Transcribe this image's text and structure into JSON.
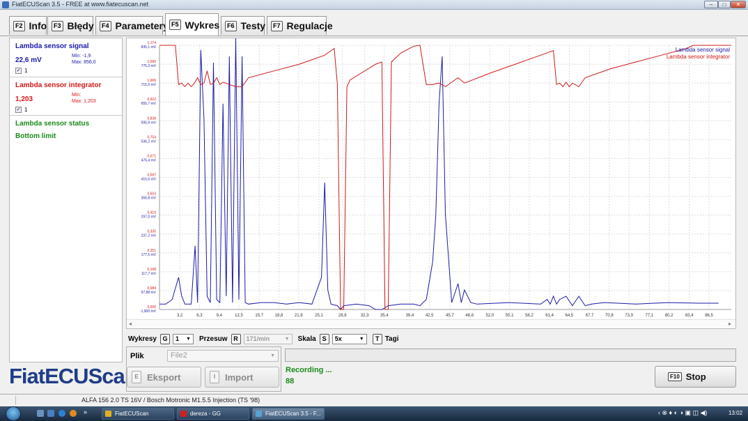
{
  "window": {
    "title": "FiatECUScan 3.5 - FREE at www.fiatecuscan.net",
    "minimize_glyph": "–",
    "maximize_glyph": "□",
    "close_glyph": "✕"
  },
  "tabs": [
    {
      "key": "F2",
      "label": "Info"
    },
    {
      "key": "F3",
      "label": "Błędy"
    },
    {
      "key": "F4",
      "label": "Parametery"
    },
    {
      "key": "F5",
      "label": "Wykres",
      "active": true
    },
    {
      "key": "F6",
      "label": "Testy"
    },
    {
      "key": "F7",
      "label": "Regulacje"
    }
  ],
  "signals": {
    "lambda_signal": {
      "name": "Lambda sensor signal",
      "value": "22,6 mV",
      "min": "Min: -1,9",
      "max": "Max: 856,0",
      "checked": "✓",
      "check_label": "1",
      "color": "#1a1aa8"
    },
    "lambda_integrator": {
      "name": "Lambda sensor integrator",
      "value": "1,203",
      "min": "Min:",
      "max": "Max: 1,203",
      "checked": "✓",
      "check_label": "1",
      "color": "#d01818"
    },
    "lambda_status": {
      "name": "Lambda sensor status",
      "value": "Bottom limit",
      "color": "#1a8a1a"
    }
  },
  "logo": "FiatECUScan",
  "chart_data": {
    "type": "line",
    "legend_placement": "top-right",
    "grid": true,
    "x_ticks": [
      "3,2",
      "6,3",
      "9,4",
      "12,5",
      "15,7",
      "18,8",
      "21,9",
      "25,1",
      "28,8",
      "32,3",
      "35,4",
      "39,4",
      "42,5",
      "45,7",
      "48,8",
      "52,0",
      "55,1",
      "58,2",
      "61,4",
      "64,5",
      "67,7",
      "70,8",
      "73,9",
      "77,1",
      "80,2",
      "83,4",
      "86,5"
    ],
    "xlim": [
      0,
      90
    ],
    "y_ticks_integrator": [
      "0,000",
      "0,084",
      "0,168",
      "0,251",
      "0,335",
      "0,419",
      "0,503",
      "0,587",
      "0,671",
      "0,754",
      "0,838",
      "0,922",
      "1,006",
      "1,090",
      "1,174"
    ],
    "y_ticks_signal": [
      "-1,900 mV",
      "57,88 mV",
      "117,7 mV",
      "177,5 mV",
      "237,2 mV",
      "297,0 mV",
      "356,8 mV",
      "416,6 mV",
      "476,4 mV",
      "536,2 mV",
      "595,9 mV",
      "655,7 mV",
      "715,5 mV",
      "775,3 mV",
      "835,1 mV"
    ],
    "series": [
      {
        "name": "Lambda sensor signal",
        "color": "#1a1aa8",
        "points": [
          [
            0,
            15
          ],
          [
            1,
            15
          ],
          [
            2,
            30
          ],
          [
            3,
            100
          ],
          [
            3.5,
            40
          ],
          [
            4,
            15
          ],
          [
            5,
            15
          ],
          [
            5.6,
            200
          ],
          [
            6,
            20
          ],
          [
            6.5,
            820
          ],
          [
            7,
            600
          ],
          [
            7.5,
            40
          ],
          [
            8,
            20
          ],
          [
            8.5,
            780
          ],
          [
            9,
            30
          ],
          [
            9.5,
            20
          ],
          [
            10,
            650
          ],
          [
            10.5,
            40
          ],
          [
            11,
            800
          ],
          [
            11.5,
            20
          ],
          [
            12,
            860
          ],
          [
            12.5,
            30
          ],
          [
            13,
            800
          ],
          [
            13.5,
            20
          ],
          [
            14,
            15
          ],
          [
            16,
            20
          ],
          [
            18,
            20
          ],
          [
            20,
            15
          ],
          [
            22,
            20
          ],
          [
            24,
            15
          ],
          [
            25.5,
            100
          ],
          [
            26,
            400
          ],
          [
            26.5,
            60
          ],
          [
            27,
            15
          ],
          [
            28,
            10
          ],
          [
            28.5,
            -2
          ],
          [
            29,
            10
          ],
          [
            31,
            15
          ],
          [
            33,
            10
          ],
          [
            34,
            -2
          ],
          [
            35,
            -2
          ],
          [
            36,
            10
          ],
          [
            38,
            15
          ],
          [
            40,
            15
          ],
          [
            41,
            10
          ],
          [
            42,
            30
          ],
          [
            43,
            150
          ],
          [
            43.5,
            300
          ],
          [
            44,
            650
          ],
          [
            44.5,
            800
          ],
          [
            45,
            300
          ],
          [
            46,
            20
          ],
          [
            47,
            80
          ],
          [
            47.5,
            20
          ],
          [
            48,
            60
          ],
          [
            49,
            20
          ],
          [
            50,
            15
          ],
          [
            55,
            20
          ],
          [
            60,
            15
          ],
          [
            61,
            30
          ],
          [
            61.5,
            15
          ],
          [
            62,
            40
          ],
          [
            62.5,
            15
          ],
          [
            63,
            30
          ],
          [
            64,
            40
          ],
          [
            65,
            10
          ],
          [
            66,
            40
          ],
          [
            67,
            10
          ],
          [
            68,
            15
          ],
          [
            70,
            20
          ],
          [
            75,
            15
          ],
          [
            80,
            20
          ],
          [
            85,
            18
          ],
          [
            88,
            18
          ]
        ]
      },
      {
        "name": "Lambda sensor integrator",
        "color": "#d01818",
        "points": [
          [
            0,
            1.174
          ],
          [
            2.5,
            1.174
          ],
          [
            3,
            1.0
          ],
          [
            3.5,
            1.006
          ],
          [
            4,
            0.99
          ],
          [
            4.5,
            1.006
          ],
          [
            5,
            0.99
          ],
          [
            5.5,
            1.006
          ],
          [
            6,
            1.03
          ],
          [
            6.5,
            1.0
          ],
          [
            7,
            1.006
          ],
          [
            7.5,
            1.06
          ],
          [
            8,
            1.0
          ],
          [
            8.5,
            1.006
          ],
          [
            9,
            1.03
          ],
          [
            9.5,
            1.0
          ],
          [
            10,
            1.01
          ],
          [
            11,
            1.0
          ],
          [
            12,
            0.99
          ],
          [
            13,
            0.99
          ],
          [
            14,
            1.03
          ],
          [
            18,
            1.06
          ],
          [
            22,
            1.09
          ],
          [
            26,
            1.13
          ],
          [
            27.5,
            1.16
          ],
          [
            28,
            1.0
          ],
          [
            28.5,
            0.0
          ],
          [
            29,
            0.0
          ],
          [
            29.5,
            0.99
          ],
          [
            30,
            1.02
          ],
          [
            34,
            1.09
          ],
          [
            35,
            1.1
          ],
          [
            35.5,
            0.0
          ],
          [
            36,
            0.0
          ],
          [
            36.5,
            1.1
          ],
          [
            38,
            1.14
          ],
          [
            40,
            1.17
          ],
          [
            41,
            1.174
          ],
          [
            42,
            1.0
          ],
          [
            43,
            1.0
          ],
          [
            44,
            1.006
          ],
          [
            45,
            0.99
          ],
          [
            46,
            1.01
          ],
          [
            47,
            1.03
          ],
          [
            48,
            1.006
          ],
          [
            52,
            1.05
          ],
          [
            56,
            1.09
          ],
          [
            60,
            1.13
          ],
          [
            62,
            1.15
          ],
          [
            62.5,
            1.0
          ],
          [
            63,
            1.006
          ],
          [
            63.5,
            0.99
          ],
          [
            64,
            1.01
          ],
          [
            64.5,
            0.99
          ],
          [
            65,
            1.006
          ],
          [
            66,
            0.99
          ],
          [
            67,
            1.03
          ],
          [
            71,
            1.07
          ],
          [
            75,
            1.1
          ],
          [
            79,
            1.13
          ],
          [
            83,
            1.16
          ],
          [
            84,
            1.174
          ],
          [
            90,
            1.174
          ]
        ]
      }
    ]
  },
  "controls": {
    "wykresy_label": "Wykresy",
    "wykresy_key": "G",
    "wykresy_value": "1",
    "przesuw_label": "Przesuw",
    "przesuw_key": "R",
    "przesuw_value": "171/min",
    "skala_label": "Skala",
    "skala_key": "S",
    "skala_value": "5x",
    "tagi_key": "T",
    "tagi_label": "Tagi",
    "dropdown_glyph": "▼"
  },
  "file": {
    "label": "Plik",
    "value": "File2",
    "export_key": "E",
    "export_label": "Eksport",
    "import_key": "I",
    "import_label": "Import"
  },
  "recording": {
    "status": "Recording ...",
    "count": "88"
  },
  "stop": {
    "key": "F10",
    "label": "Stop"
  },
  "statusbar": {
    "text": "ALFA 156 2.0 TS 16V / Bosch Motronic M1.5.5 Injection (TS '98)"
  },
  "taskbar": {
    "overflow_glyph": "»",
    "items": [
      {
        "label": "FiatECUScan",
        "color": "#e0b020"
      },
      {
        "label": "dereza - GG",
        "color": "#d02020"
      },
      {
        "label": "FiatECUScan 3.5 - F...",
        "color": "#5aa0d0"
      }
    ],
    "tray_text": "‹ ⊗ ♦ ◐ ◑   ▣ ◫ ◀)",
    "clock": "13:02"
  }
}
